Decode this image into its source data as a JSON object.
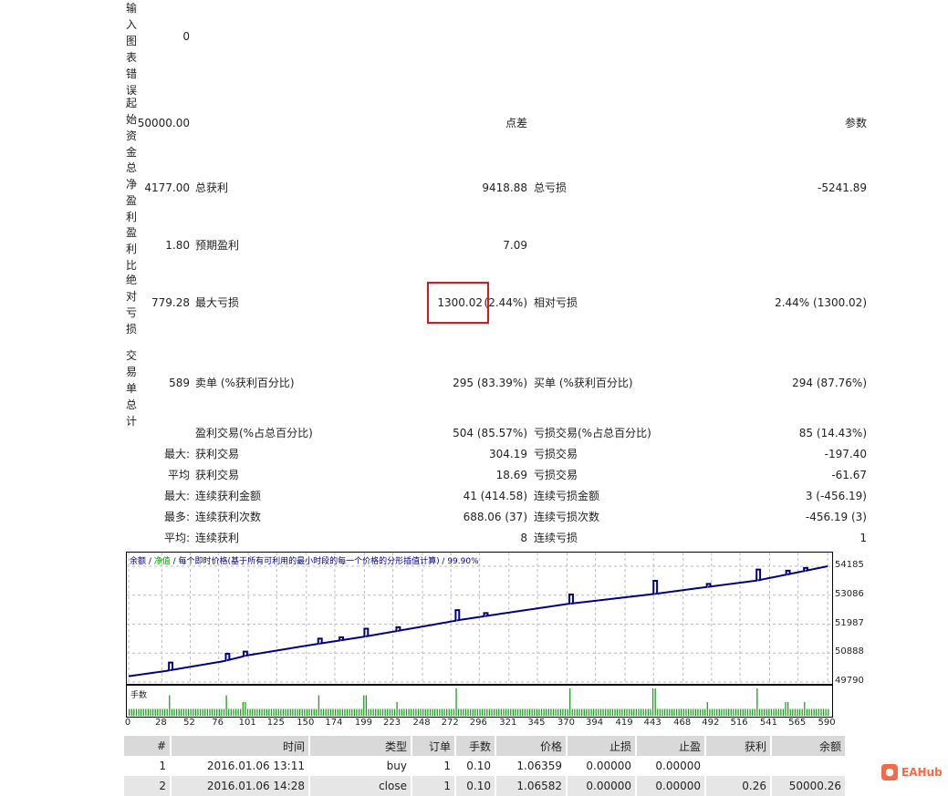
{
  "stats": {
    "rows": [
      {
        "label": "输入图表错误",
        "value": "0"
      },
      {
        "label": "起始资金",
        "value": "50000.00",
        "mid_label": "",
        "mid_value": "点差",
        "right_label": "",
        "right_value": "参数"
      },
      {
        "label": "总净盈利",
        "value": "4177.00",
        "mid_label": "总获利",
        "mid_value": "9418.88",
        "right_label": "总亏损",
        "right_value": "-5241.89"
      },
      {
        "label": "盈利比",
        "value": "1.80",
        "mid_label": "预期盈利",
        "mid_value": "7.09"
      },
      {
        "label": "绝对亏损",
        "value": "779.28",
        "mid_label": "最大亏损",
        "mid_value": "1300.02",
        "mid_value_pct": "(2.44%)",
        "right_label": "相对亏损",
        "right_value": "2.44% (1300.02)"
      },
      {
        "label": "交易单总计",
        "value": "589",
        "mid_label": "卖单 (%获利百分比)",
        "mid_value": "295 (83.39%)",
        "right_label": "买单 (%获利百分比)",
        "right_value": "294 (87.76%)"
      }
    ],
    "lower": [
      {
        "prefix": "",
        "mid_label": "盈利交易(%占总百分比)",
        "mid_value": "504 (85.57%)",
        "right_label": "亏损交易(%占总百分比)",
        "right_value": "85 (14.43%)"
      },
      {
        "prefix": "最大:",
        "mid_label": "获利交易",
        "mid_value": "304.19",
        "right_label": "亏损交易",
        "right_value": "-197.40"
      },
      {
        "prefix": "平均",
        "mid_label": "获利交易",
        "mid_value": "18.69",
        "right_label": "亏损交易",
        "right_value": "-61.67"
      },
      {
        "prefix": "最大:",
        "mid_label": "连续获利金额",
        "mid_value": "41 (414.58)",
        "right_label": "连续亏损金额",
        "right_value": "3 (-456.19)"
      },
      {
        "prefix": "最多:",
        "mid_label": "连续获利次数",
        "mid_value": "688.06 (37)",
        "right_label": "连续亏损次数",
        "right_value": "-456.19 (3)"
      },
      {
        "prefix": "平均:",
        "mid_label": "连续获利",
        "mid_value": "8",
        "right_label": "连续亏损",
        "right_value": "1"
      }
    ]
  },
  "chart_data": {
    "type": "line",
    "legend": {
      "balance": "余额",
      "sep1": " / ",
      "equity": "净值",
      "rest": " / 每个即时价格(基于所有可利用的最小时段的每一个价格的分形插值计算) / 99.90%"
    },
    "y_ticks": [
      "54185",
      "53086",
      "51987",
      "50888",
      "49790"
    ],
    "ylim": [
      49790,
      54185
    ],
    "x_ticks": [
      "0",
      "28",
      "52",
      "76",
      "101",
      "125",
      "150",
      "174",
      "199",
      "223",
      "248",
      "272",
      "296",
      "321",
      "345",
      "370",
      "394",
      "419",
      "443",
      "468",
      "492",
      "516",
      "541",
      "565",
      "590"
    ],
    "xlim": [
      0,
      593
    ],
    "balance": [
      [
        0,
        50010
      ],
      [
        30,
        50200
      ],
      [
        80,
        50580
      ],
      [
        100,
        50800
      ],
      [
        150,
        51170
      ],
      [
        200,
        51520
      ],
      [
        250,
        51910
      ],
      [
        280,
        52150
      ],
      [
        320,
        52420
      ],
      [
        370,
        52750
      ],
      [
        445,
        53140
      ],
      [
        480,
        53350
      ],
      [
        530,
        53640
      ],
      [
        560,
        53910
      ],
      [
        590,
        54185
      ]
    ],
    "equity_spikes": [
      [
        34,
        300
      ],
      [
        82,
        260
      ],
      [
        97,
        180
      ],
      [
        160,
        200
      ],
      [
        178,
        120
      ],
      [
        199,
        300
      ],
      [
        226,
        150
      ],
      [
        276,
        400
      ],
      [
        300,
        120
      ],
      [
        372,
        350
      ],
      [
        443,
        500
      ],
      [
        488,
        120
      ],
      [
        530,
        420
      ],
      [
        555,
        150
      ],
      [
        570,
        120
      ]
    ],
    "volume_label": "手数",
    "volume_base": 0.1,
    "volume_spikes": [
      [
        34,
        0.3
      ],
      [
        82,
        0.3
      ],
      [
        97,
        0.2
      ],
      [
        160,
        0.3
      ],
      [
        199,
        0.3
      ],
      [
        226,
        0.2
      ],
      [
        276,
        0.4
      ],
      [
        372,
        0.4
      ],
      [
        443,
        0.4
      ],
      [
        488,
        0.2
      ],
      [
        530,
        0.4
      ],
      [
        555,
        0.2
      ],
      [
        570,
        0.2
      ]
    ],
    "colors": {
      "balance": "#000080",
      "equity": "#00a000",
      "volume": "#1ea01e"
    }
  },
  "deals": {
    "headers": [
      "#",
      "时间",
      "类型",
      "订单",
      "手数",
      "价格",
      "止损",
      "止盈",
      "获利",
      "余额"
    ],
    "rows": [
      [
        "1",
        "2016.01.06 13:11",
        "buy",
        "1",
        "0.10",
        "1.06359",
        "0.00000",
        "0.00000",
        "",
        ""
      ],
      [
        "2",
        "2016.01.06 14:28",
        "close",
        "1",
        "0.10",
        "1.06582",
        "0.00000",
        "0.00000",
        "0.26",
        "50000.26"
      ]
    ]
  },
  "watermark": "EAHub"
}
